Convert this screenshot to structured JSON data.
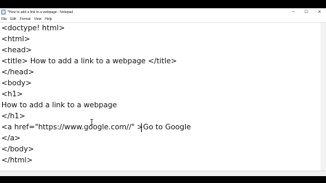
{
  "window": {
    "title": "*How to add a link to a webpage - Notepad",
    "controls": {
      "minimize": "─",
      "maximize": "☐",
      "close": "✕"
    }
  },
  "menu": [
    "File",
    "Edit",
    "Format",
    "View",
    "Help"
  ],
  "editor": {
    "lines": [
      "<doctype! html>",
      "<html>",
      "<head>",
      "<title> How to add a link to a webpage </title>",
      "</head>",
      "<body>",
      "<h1>",
      "How to add a link to a webpage",
      "</h1>",
      "<a href=\"https://www.google.com//\" >Go to Google",
      "</a>",
      "</body>",
      "</html>"
    ]
  },
  "icons": {
    "app": "notepad-icon",
    "cursor": "i-beam-cursor-icon",
    "caret": "text-caret"
  }
}
